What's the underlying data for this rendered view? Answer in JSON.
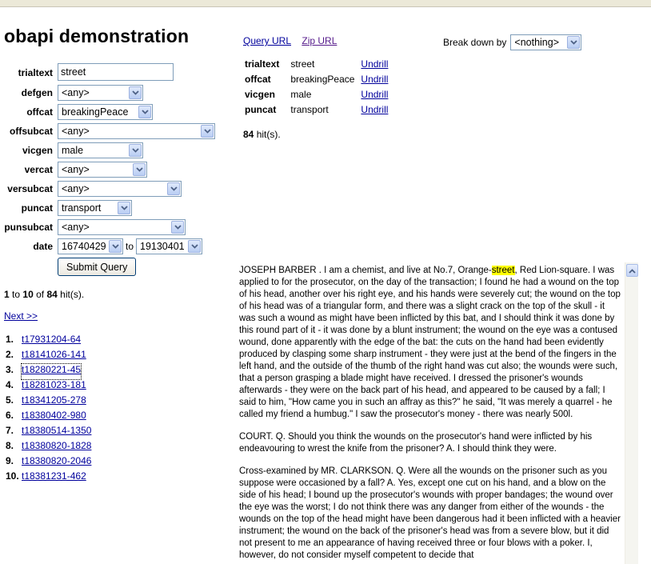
{
  "page": {
    "title": "obapi demonstration"
  },
  "form": {
    "fields": [
      {
        "label": "trialtext",
        "value": "street"
      },
      {
        "label": "defgen",
        "value": "<any>"
      },
      {
        "label": "offcat",
        "value": "breakingPeace"
      },
      {
        "label": "offsubcat",
        "value": "<any>"
      },
      {
        "label": "vicgen",
        "value": "male"
      },
      {
        "label": "vercat",
        "value": "<any>"
      },
      {
        "label": "versubcat",
        "value": "<any>"
      },
      {
        "label": "puncat",
        "value": "transport"
      },
      {
        "label": "punsubcat",
        "value": "<any>"
      }
    ],
    "date_label": "date",
    "date_from": "16740429",
    "date_to_label": "to",
    "date_to": "19130401",
    "submit_label": "Submit Query"
  },
  "results": {
    "range_start": "1",
    "range_to_word": "to",
    "range_end": "10",
    "of_word": "of",
    "total": "84",
    "hits_suffix": "hit(s).",
    "next_label": "Next >>",
    "items": [
      {
        "num": "1.",
        "id": "t17931204-64"
      },
      {
        "num": "2.",
        "id": "t18141026-141"
      },
      {
        "num": "3.",
        "id": "t18280221-45"
      },
      {
        "num": "4.",
        "id": "t18281023-181"
      },
      {
        "num": "5.",
        "id": "t18341205-278"
      },
      {
        "num": "6.",
        "id": "t18380402-980"
      },
      {
        "num": "7.",
        "id": "t18380514-1350"
      },
      {
        "num": "8.",
        "id": "t18380820-1828"
      },
      {
        "num": "9.",
        "id": "t18380820-2046"
      },
      {
        "num": "10.",
        "id": "t18381231-462"
      }
    ]
  },
  "query": {
    "query_url_label": "Query URL",
    "zip_url_label": "Zip URL",
    "breakdown_label": "Break down by",
    "breakdown_value": "<nothing>",
    "undrill_label": "Undrill",
    "criteria": [
      {
        "key": "trialtext",
        "value": "street"
      },
      {
        "key": "offcat",
        "value": "breakingPeace"
      },
      {
        "key": "vicgen",
        "value": "male"
      },
      {
        "key": "puncat",
        "value": "transport"
      }
    ],
    "total": "84",
    "hits_suffix": "hit(s)."
  },
  "text": {
    "p1_before": "JOSEPH BARBER . I am a chemist, and live at No.7, Orange-",
    "p1_highlight": "street",
    "p1_after": ", Red Lion-square. I was applied to for the prosecutor, on the day of the transaction; I found he had a wound on the top of his head, another over his right eye, and his hands were severely cut; the wound on the top of his head was of a triangular form, and there was a slight crack on the top of the skull - it was such a wound as might have been inflicted by this bat, and I should think it was done by this round part of it - it was done by a blunt instrument; the wound on the eye was a contused wound, done apparently with the edge of the bat: the cuts on the hand had been evidently produced by clasping some sharp instrument - they were just at the bend of the fingers in the left hand, and the outside of the thumb of the right hand was cut also; the wounds were such, that a person grasping a blade might have received. I dressed the prisoner's wounds afterwards - they were on the back part of his head, and appeared to be caused by a fall; I said to him, \"How came you in such an affray as this?\" he said, \"It was merely a quarrel - he called my friend a humbug.\" I saw the prosecutor's money - there was nearly 500l.",
    "p2": "COURT. Q. Should you think the wounds on the prosecutor's hand were inflicted by his endeavouring to wrest the knife from the prisoner? A. I should think they were.",
    "p3": "Cross-examined by MR. CLARKSON. Q. Were all the wounds on the prisoner such as you suppose were occasioned by a fall? A. Yes, except one cut on his hand, and a blow on the side of his head; I bound up the prosecutor's wounds with proper bandages; the wound over the eye was the worst; I do not think there was any danger from either of the wounds - the wounds on the top of the head might have been dangerous had it been inflicted with a heavier instrument; the wound on the back of the prisoner's head was from a severe blow, but it did not present to me an appearance of having received three or four blows with a poker. I, however, do not consider myself competent to decide that"
  }
}
